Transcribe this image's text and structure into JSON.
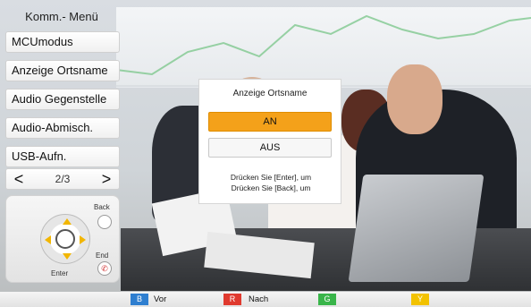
{
  "menu": {
    "title": "Komm.- Menü",
    "items": [
      {
        "label": "MCUmodus"
      },
      {
        "label": "Anzeige Ortsname"
      },
      {
        "label": "Audio Gegenstelle"
      },
      {
        "label": "Audio-Abmisch."
      },
      {
        "label": "USB-Aufn."
      }
    ],
    "pager": {
      "prev": "<",
      "page": "2/3",
      "next": ">"
    }
  },
  "remote": {
    "back_label": "Back",
    "end_label": "End",
    "enter_label": "Enter"
  },
  "dialog": {
    "title": "Anzeige Ortsname",
    "options": [
      {
        "label": "AN",
        "selected": true
      },
      {
        "label": "AUS",
        "selected": false
      }
    ],
    "hint_lines": [
      "Drücken Sie [Enter], um",
      "Drücken Sie [Back], um"
    ]
  },
  "bottom_bar": {
    "buttons": [
      {
        "key": "B",
        "label": "Vor",
        "color": "#2f7fd0"
      },
      {
        "key": "R",
        "label": "Nach",
        "color": "#e03a2f"
      },
      {
        "key": "G",
        "label": "",
        "color": "#39b54a"
      },
      {
        "key": "Y",
        "label": "",
        "color": "#f2c200"
      }
    ]
  },
  "colors": {
    "selected_option": "#f4a11a"
  }
}
